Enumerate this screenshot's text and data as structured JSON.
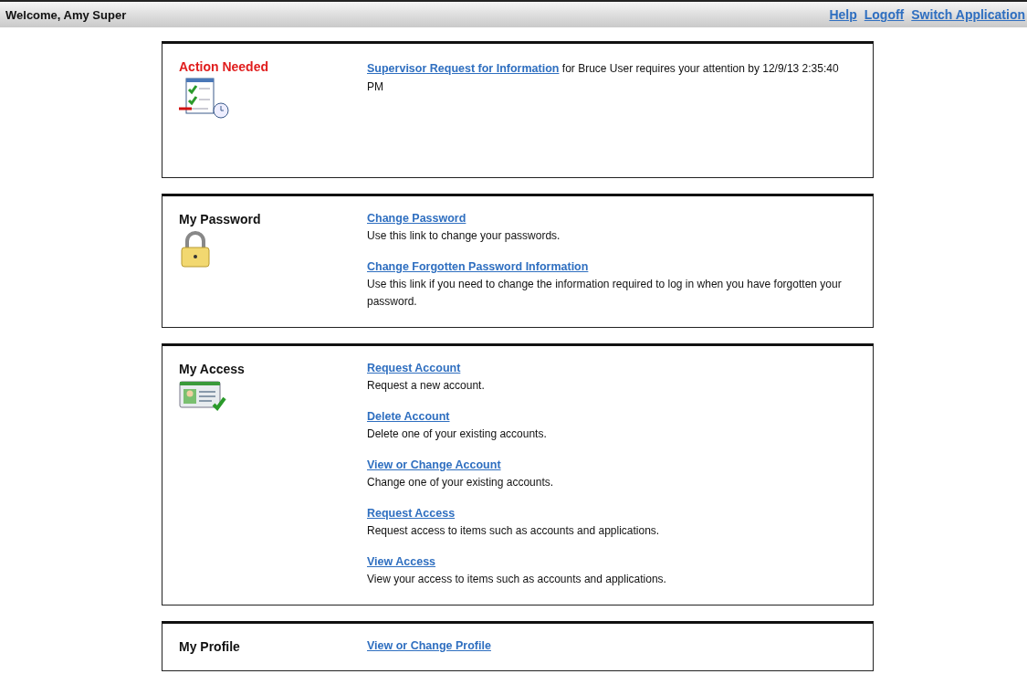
{
  "header": {
    "welcome": "Welcome, Amy Super",
    "links": [
      "Help",
      "Logoff",
      "Switch Application"
    ]
  },
  "panels": [
    {
      "kind": "alert",
      "title": "Action Needed",
      "link": "Supervisor Request for Information",
      "message": "for Bruce User requires your attention by 12/9/13 2:35:40 PM"
    },
    {
      "kind": "password",
      "title": "My Password",
      "items": [
        {
          "link": "Change Password",
          "text": "Use this link to change your passwords."
        },
        {
          "link": "Change Forgotten Password Information",
          "text": "Use this link if you need to change the information required to log in when you have forgotten your password."
        }
      ]
    },
    {
      "kind": "access",
      "title": "My Access",
      "items": [
        {
          "link": "Request Account",
          "text": "Request a new account."
        },
        {
          "link": "Delete Account",
          "text": "Delete one of your existing accounts."
        },
        {
          "link": "View or Change Account",
          "text": "Change one of your existing accounts."
        },
        {
          "link": "Request Access",
          "text": "Request access to items such as accounts and applications."
        },
        {
          "link": "View Access",
          "text": "View your access to items such as accounts and applications."
        }
      ]
    },
    {
      "kind": "profile",
      "title": "My Profile",
      "items": [
        {
          "link": "View or Change Profile"
        }
      ]
    }
  ]
}
